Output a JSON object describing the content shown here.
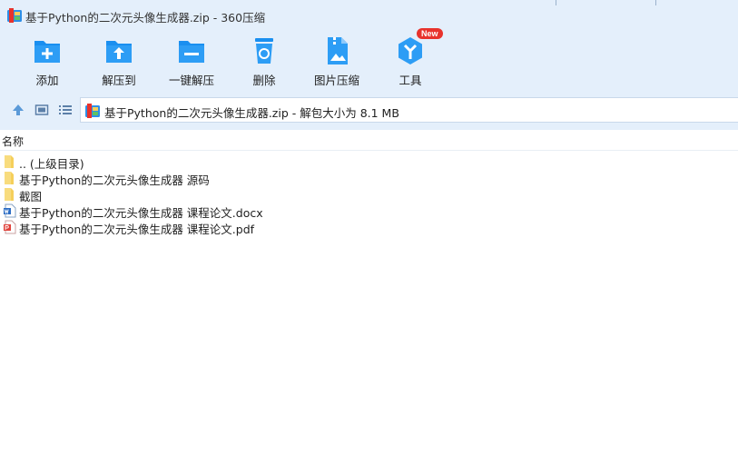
{
  "window": {
    "title": "基于Python的二次元头像生成器.zip - 360压缩"
  },
  "toolbar": {
    "items": [
      {
        "label": "添加",
        "icon": "add-icon"
      },
      {
        "label": "解压到",
        "icon": "extract-to-icon"
      },
      {
        "label": "一键解压",
        "icon": "one-click-extract-icon"
      },
      {
        "label": "删除",
        "icon": "delete-icon"
      },
      {
        "label": "图片压缩",
        "icon": "image-compress-icon"
      },
      {
        "label": "工具",
        "icon": "tools-icon",
        "badge": "New"
      }
    ]
  },
  "navbar": {
    "address": "基于Python的二次元头像生成器.zip - 解包大小为 8.1 MB"
  },
  "list": {
    "column_name": "名称",
    "rows": [
      {
        "name": ".. (上级目录)",
        "type": "folder"
      },
      {
        "name": "基于Python的二次元头像生成器 源码",
        "type": "folder"
      },
      {
        "name": "截图",
        "type": "folder"
      },
      {
        "name": "基于Python的二次元头像生成器 课程论文.docx",
        "type": "docx"
      },
      {
        "name": "基于Python的二次元头像生成器 课程论文.pdf",
        "type": "pdf"
      }
    ]
  },
  "colors": {
    "accent": "#1a8ff0",
    "toolbar_bg": "#e4effb",
    "folder": "#f5cf5b",
    "badge": "#e8322c"
  }
}
